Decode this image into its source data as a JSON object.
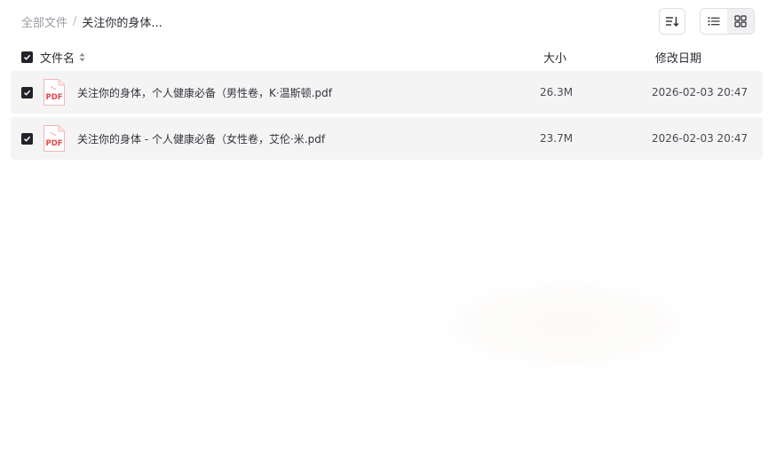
{
  "breadcrumb": {
    "root": "全部文件",
    "separator": "/",
    "current": "关注你的身体..."
  },
  "toolbar": {
    "sort_icon": "sort-icon",
    "list_view_icon": "list-view-icon",
    "grid_view_icon": "grid-view-icon",
    "active_view": "list"
  },
  "table": {
    "headers": {
      "name": "文件名",
      "size": "大小",
      "date": "修改日期"
    },
    "select_all_checked": true,
    "rows": [
      {
        "checked": true,
        "icon": "pdf-file-icon",
        "icon_label": "PDF",
        "name": "关注你的身体，个人健康必备（男性卷，K·温斯顿.pdf",
        "size": "26.3M",
        "date": "2026-02-03 20:47"
      },
      {
        "checked": true,
        "icon": "pdf-file-icon",
        "icon_label": "PDF",
        "name": "关注你的身体 - 个人健康必备（女性卷，艾伦·米.pdf",
        "size": "23.7M",
        "date": "2026-02-03 20:47"
      }
    ]
  },
  "colors": {
    "checkbox": "#22222a",
    "row_background": "#f4f4f5",
    "pdf_red": "#e5484d"
  }
}
